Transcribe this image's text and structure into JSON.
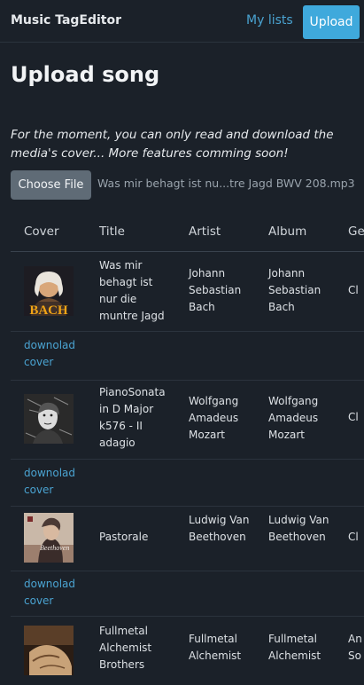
{
  "header": {
    "brand": "Music TagEditor",
    "nav_my_lists": "My lists",
    "upload_label": "Upload"
  },
  "page": {
    "title": "Upload song",
    "notice": "For the moment, you can only read and download the media's cover... More features comming soon!",
    "file_button": "Choose File",
    "file_name": "Was mir behagt ist nu...tre Jagd BWV 208.mp3"
  },
  "table": {
    "columns": [
      "Cover",
      "Title",
      "Artist",
      "Album",
      "Ge"
    ],
    "download_label": "downolad cover",
    "rows": [
      {
        "cover": "bach-portrait-cover",
        "cover_text": "BACH",
        "title": "Was mir behagt ist nur die muntre Jagd",
        "artist": "Johann Sebastian Bach",
        "album": "Johann Sebastian Bach",
        "genre": "Cl"
      },
      {
        "cover": "mozart-sketch-cover",
        "title": "PianoSonata in D Major k576 - II adagio",
        "artist": "Wolfgang Amadeus Mozart",
        "album": "Wolfgang Amadeus Mozart",
        "genre": "Cl"
      },
      {
        "cover": "beethoven-cover",
        "title": "Pastorale",
        "artist": "Ludwig Van Beethoven",
        "album": "Ludwig Van Beethoven",
        "genre": "Cl"
      },
      {
        "cover": "fullmetal-cover",
        "title": "Fullmetal Alchemist Brothers",
        "artist": "Fullmetal Alchemist",
        "album": "Fullmetal Alchemist",
        "genre": "An So"
      }
    ]
  },
  "colors": {
    "background": "#1b2129",
    "accent": "#3fa9dc",
    "link": "#4aa3d1"
  }
}
